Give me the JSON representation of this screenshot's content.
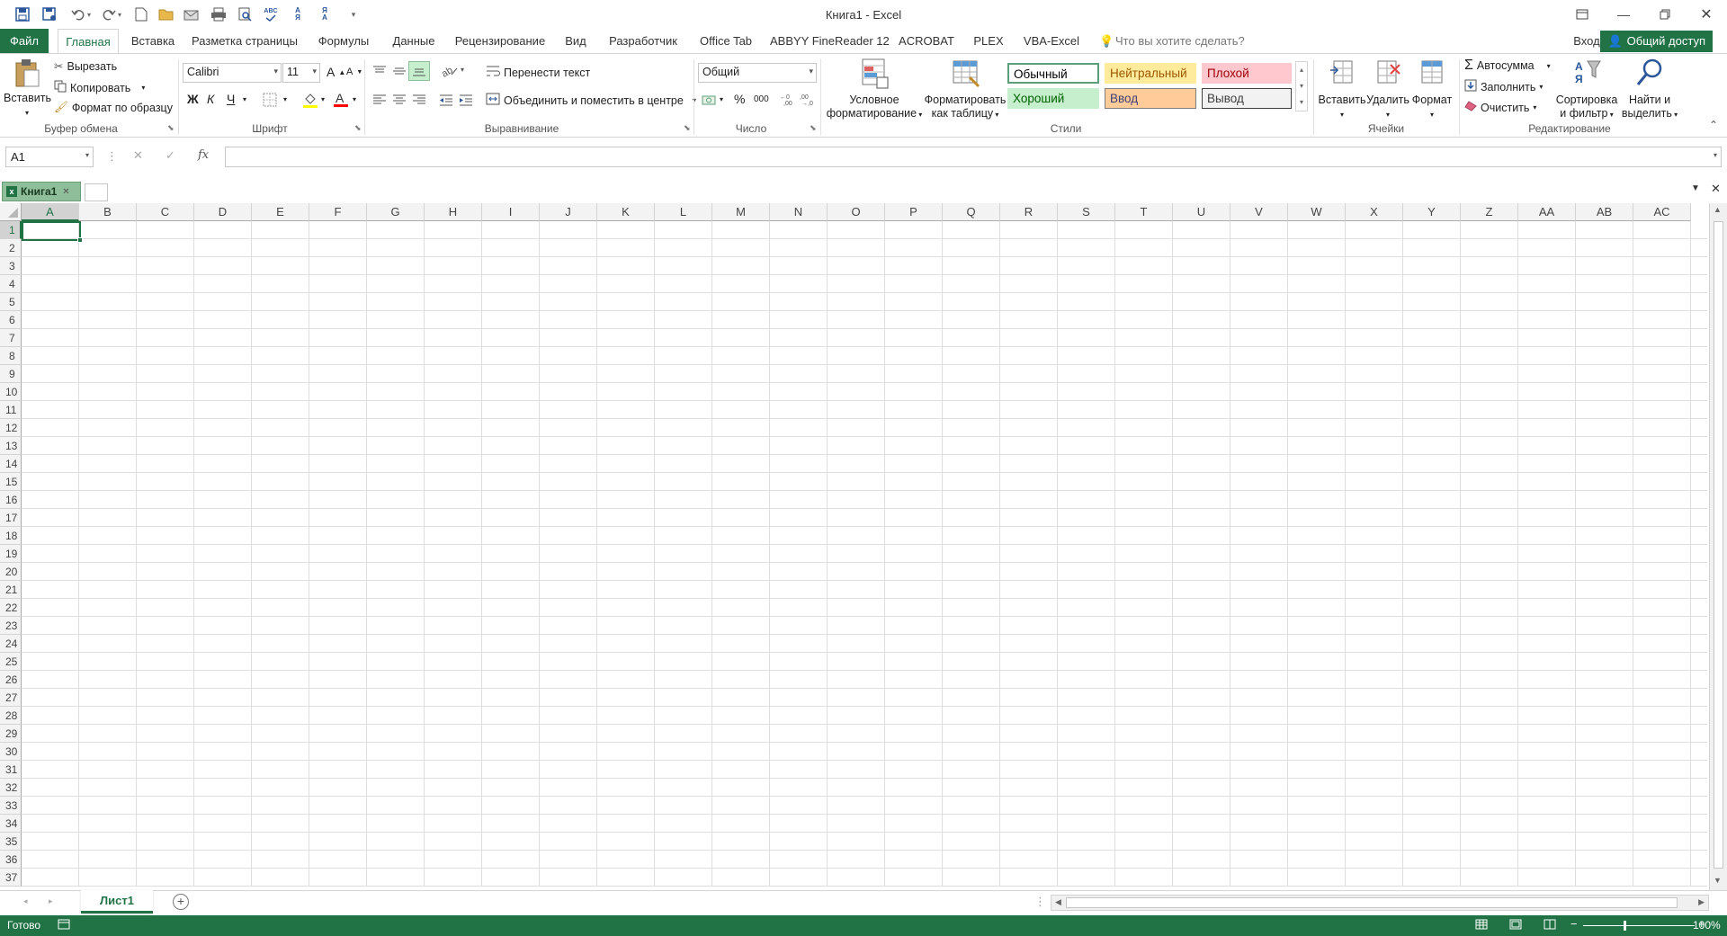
{
  "window": {
    "title": "Книга1 - Excel"
  },
  "tabs": [
    "Файл",
    "Главная",
    "Вставка",
    "Разметка страницы",
    "Формулы",
    "Данные",
    "Рецензирование",
    "Вид",
    "Разработчик",
    "Office Tab",
    "ABBYY FineReader 12",
    "ACROBAT",
    "PLEX",
    "VBA-Excel"
  ],
  "tell_me": "Что вы хотите сделать?",
  "signin": "Вход",
  "share": "Общий доступ",
  "clipboard": {
    "paste": "Вставить",
    "cut": "Вырезать",
    "copy": "Копировать",
    "format_painter": "Формат по образцу",
    "label": "Буфер обмена"
  },
  "font": {
    "name": "Calibri",
    "size": "11",
    "bold": "Ж",
    "italic": "К",
    "underline": "Ч",
    "label": "Шрифт"
  },
  "alignment": {
    "wrap": "Перенести текст",
    "merge": "Объединить и поместить в центре",
    "label": "Выравнивание"
  },
  "number": {
    "format": "Общий",
    "label": "Число",
    "percent": "%",
    "thousands": "000"
  },
  "styles": {
    "conditional": "Условное форматирование",
    "format_table": "Форматировать как таблицу",
    "label": "Стили",
    "items": [
      {
        "name": "Обычный",
        "bg": "#ffffff",
        "fg": "#000000",
        "border": "#5b9f7a"
      },
      {
        "name": "Нейтральный",
        "bg": "#ffeb9c",
        "fg": "#9c5700",
        "border": "#ffeb9c"
      },
      {
        "name": "Плохой",
        "bg": "#ffc7ce",
        "fg": "#9c0006",
        "border": "#ffc7ce"
      },
      {
        "name": "Хороший",
        "bg": "#c6efce",
        "fg": "#006100",
        "border": "#c6efce"
      },
      {
        "name": "Ввод",
        "bg": "#ffcc99",
        "fg": "#3f3f76",
        "border": "#7f7f7f"
      },
      {
        "name": "Вывод",
        "bg": "#f2f2f2",
        "fg": "#3f3f3f",
        "border": "#3f3f3f"
      }
    ]
  },
  "cells_group": {
    "insert": "Вставить",
    "delete": "Удалить",
    "format": "Формат",
    "label": "Ячейки"
  },
  "editing": {
    "autosum": "Автосумма",
    "fill": "Заполнить",
    "clear": "Очистить",
    "sort": "Сортировка и фильтр",
    "find": "Найти и выделить",
    "label": "Редактирование"
  },
  "formula_bar": {
    "name_box": "A1",
    "fx": "fx"
  },
  "workbook_tab": "Книга1",
  "columns": [
    "A",
    "B",
    "C",
    "D",
    "E",
    "F",
    "G",
    "H",
    "I",
    "J",
    "K",
    "L",
    "M",
    "N",
    "O",
    "P",
    "Q",
    "R",
    "S",
    "T",
    "U",
    "V",
    "W",
    "X",
    "Y",
    "Z",
    "AA",
    "AB",
    "AC"
  ],
  "rows": [
    "1",
    "2",
    "3",
    "4",
    "5",
    "6",
    "7",
    "8",
    "9",
    "10",
    "11",
    "12",
    "13",
    "14",
    "15",
    "16",
    "17",
    "18",
    "19",
    "20",
    "21",
    "22",
    "23",
    "24",
    "25",
    "26",
    "27",
    "28",
    "29",
    "30",
    "31",
    "32",
    "33",
    "34",
    "35",
    "36",
    "37"
  ],
  "sheet": "Лист1",
  "status": {
    "ready": "Готово",
    "zoom": "100%"
  },
  "colors": {
    "accent": "#217346"
  }
}
